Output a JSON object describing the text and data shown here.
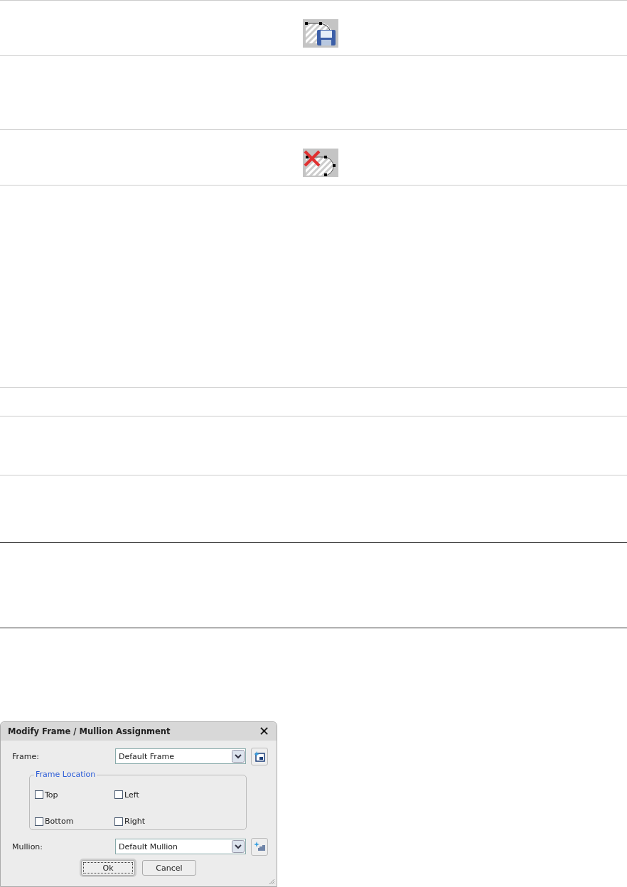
{
  "rows": [
    {
      "kind": "save"
    },
    {
      "kind": "blank"
    },
    {
      "kind": "delete"
    },
    {
      "kind": "blank"
    },
    {
      "kind": "blank"
    },
    {
      "kind": "blank"
    },
    {
      "kind": "blank"
    },
    {
      "kind": "blank"
    }
  ],
  "dialog": {
    "title": "Modify Frame / Mullion Assignment",
    "close": "✕",
    "frame": {
      "label": "Frame:",
      "value": "Default Frame"
    },
    "group": {
      "legend": "Frame Location",
      "options": [
        {
          "label": "Top",
          "checked": false
        },
        {
          "label": "Left",
          "checked": false
        },
        {
          "label": "Bottom",
          "checked": false
        },
        {
          "label": "Right",
          "checked": false
        }
      ]
    },
    "mullion": {
      "label": "Mullion:",
      "value": "Default Mullion"
    },
    "buttons": [
      {
        "label": "Ok",
        "focused": true
      },
      {
        "label": "Cancel",
        "focused": false
      }
    ]
  }
}
